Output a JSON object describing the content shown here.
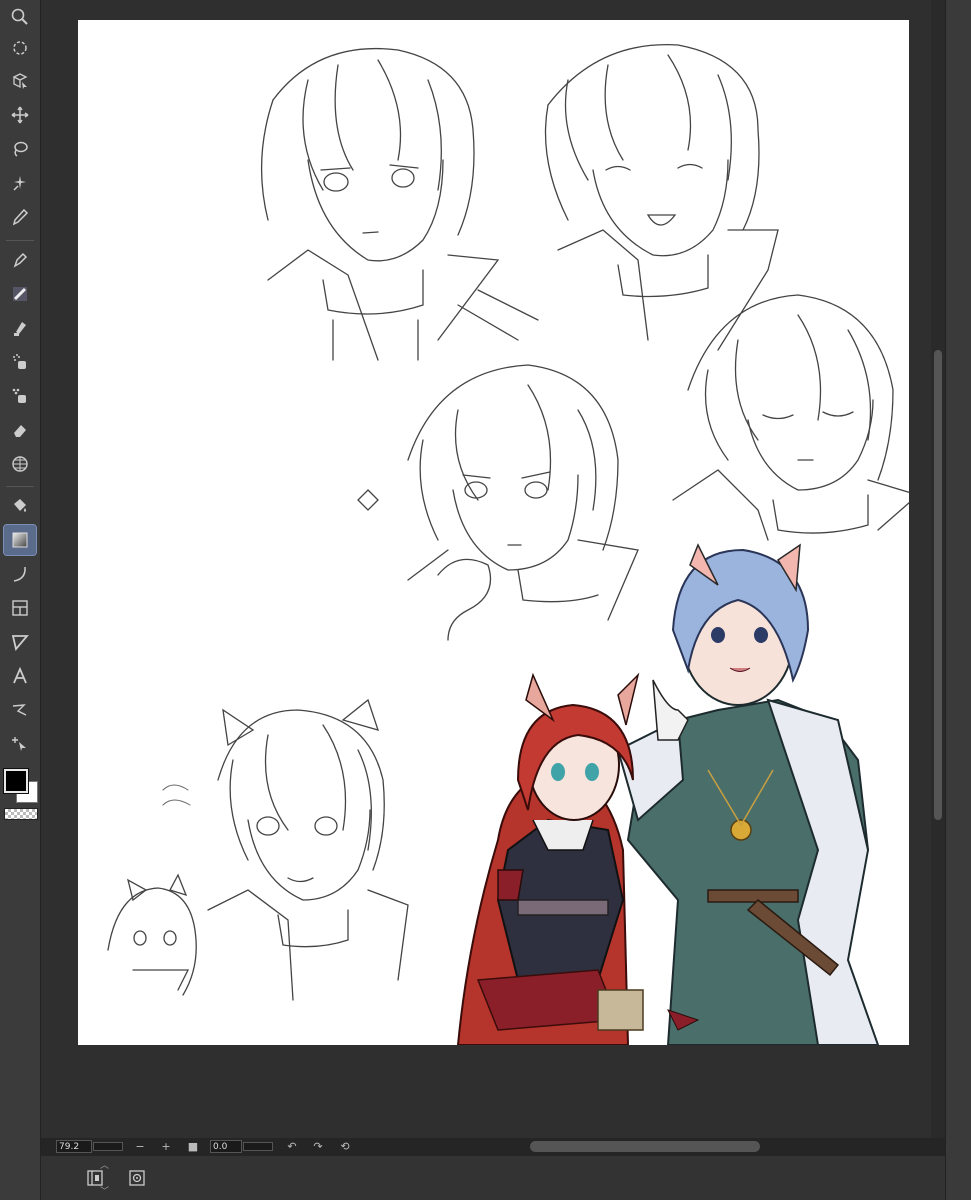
{
  "toolbar": {
    "tools": [
      {
        "name": "zoom-tool",
        "icon": "magnifier-icon"
      },
      {
        "name": "rotate-tool",
        "icon": "rotate-icon"
      },
      {
        "name": "object-tool",
        "icon": "object-icon"
      },
      {
        "name": "move-tool",
        "icon": "move-arrows-icon"
      },
      {
        "name": "lasso-tool",
        "icon": "lasso-icon"
      },
      {
        "name": "auto-select-tool",
        "icon": "magic-wand-icon"
      },
      {
        "name": "eyedropper-tool",
        "icon": "eyedropper-icon"
      },
      {
        "name": "pen-tool",
        "icon": "pen-icon"
      },
      {
        "name": "brush-tool",
        "icon": "brush-icon"
      },
      {
        "name": "marker-tool",
        "icon": "marker-icon"
      },
      {
        "name": "airbrush-tool",
        "icon": "airbrush-icon"
      },
      {
        "name": "decoration-tool",
        "icon": "decoration-icon"
      },
      {
        "name": "eraser-tool",
        "icon": "eraser-icon"
      },
      {
        "name": "blend-tool",
        "icon": "blend-grid-icon"
      },
      {
        "name": "fill-tool",
        "icon": "fill-bucket-icon"
      },
      {
        "name": "gradient-tool",
        "icon": "gradient-icon",
        "active": true
      },
      {
        "name": "figure-tool",
        "icon": "curve-icon"
      },
      {
        "name": "frame-tool",
        "icon": "frame-icon"
      },
      {
        "name": "balloon-tool",
        "icon": "ruler-triangle-icon"
      },
      {
        "name": "text-tool",
        "icon": "text-A-icon"
      },
      {
        "name": "correct-line-tool",
        "icon": "correct-line-icon"
      },
      {
        "name": "operation-tool",
        "icon": "pointer-icon"
      }
    ],
    "main_color": "#000000",
    "sub_color": "#ffffff"
  },
  "navigator": {
    "zoom_value": "79.2",
    "rotation_value": "0.0",
    "zoom_out_label": "−",
    "zoom_in_label": "+",
    "fit_label": "■",
    "rotate_left_label": "↶",
    "rotate_right_label": "↷",
    "reset_label": "⟲"
  },
  "canvas": {
    "background": "#ffffff",
    "artwork": "character-sketches-and-colored-illustration"
  },
  "colors": {
    "toolbar_bg": "#3b3b3b",
    "workspace_bg": "#2f2f2f",
    "active_tool": "#5a6b8c"
  }
}
